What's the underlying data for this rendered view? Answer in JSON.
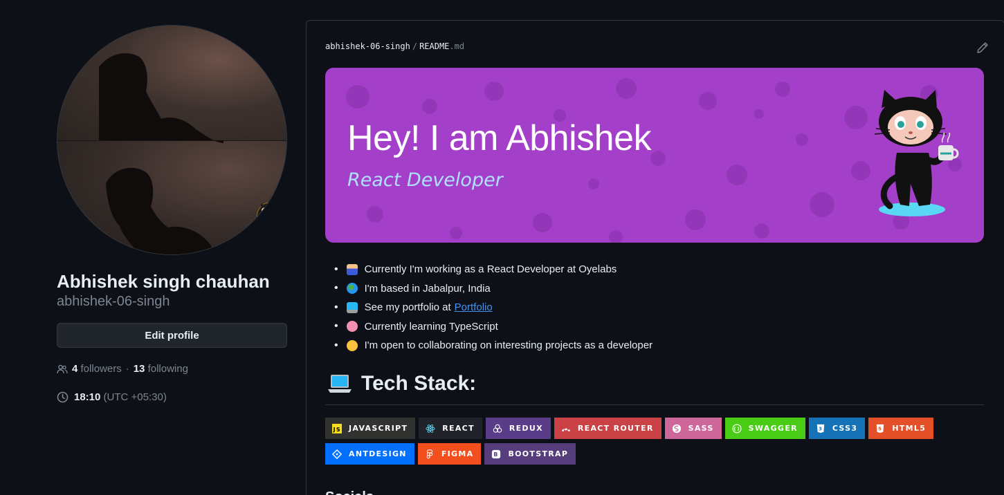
{
  "profile": {
    "name": "Abhishek singh chauhan",
    "login": "abhishek-06-singh",
    "edit_label": "Edit profile",
    "followers_count": "4",
    "followers_label": "followers",
    "following_count": "13",
    "following_label": "following",
    "local_time": "18:10",
    "timezone": "(UTC +05:30)"
  },
  "readme": {
    "path_owner": "abhishek-06-singh",
    "path_sep": "/",
    "path_file": "README",
    "path_ext": ".md",
    "banner_title": "Hey! I am Abhishek",
    "banner_subtitle": "React Developer",
    "bullets": [
      {
        "text": "Currently I'm working as a React Developer at Oyelabs",
        "icon": "office-worker-emoji"
      },
      {
        "text": "I'm based in Jabalpur, India",
        "icon": "globe-emoji"
      },
      {
        "text": "See my portfolio at",
        "link": "Portfolio",
        "icon": "computer-emoji"
      },
      {
        "text": "Currently learning TypeScript",
        "icon": "brain-emoji"
      },
      {
        "text": "I'm open to collaborating on interesting projects as a developer",
        "icon": "handshake-emoji"
      }
    ],
    "tech_heading": "Tech Stack:",
    "badges": [
      {
        "label": "JAVASCRIPT",
        "color": "#323330",
        "icon": "javascript-icon"
      },
      {
        "label": "REACT",
        "color": "#20232a",
        "icon": "react-icon"
      },
      {
        "label": "REDUX",
        "color": "#593d88",
        "icon": "redux-icon"
      },
      {
        "label": "REACT ROUTER",
        "color": "#ca4245",
        "icon": "react-router-icon"
      },
      {
        "label": "SASS",
        "color": "#cd6799",
        "icon": "sass-icon"
      },
      {
        "label": "SWAGGER",
        "color": "#48cc15",
        "icon": "swagger-icon"
      },
      {
        "label": "CSS3",
        "color": "#1572b6",
        "icon": "css3-icon"
      },
      {
        "label": "HTML5",
        "color": "#e34f26",
        "icon": "html5-icon"
      },
      {
        "label": "ANTDESIGN",
        "color": "#0170fe",
        "icon": "antdesign-icon"
      },
      {
        "label": "FIGMA",
        "color": "#f24e1e",
        "icon": "figma-icon"
      },
      {
        "label": "BOOTSTRAP",
        "color": "#563d7c",
        "icon": "bootstrap-icon"
      }
    ],
    "socials_heading": "Socials"
  }
}
